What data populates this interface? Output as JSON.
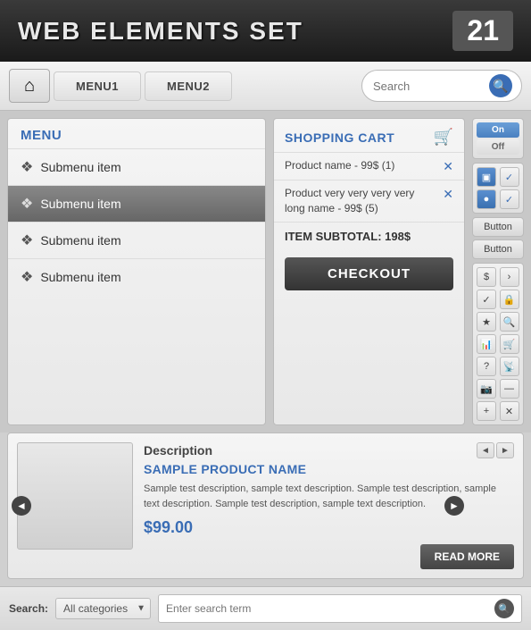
{
  "header": {
    "title": "WEB ELEMENTS SET",
    "number": "21"
  },
  "navbar": {
    "home_icon": "⌂",
    "menu1_label": "MENU1",
    "menu2_label": "MENU2",
    "search_placeholder": "Search"
  },
  "menu": {
    "title": "MENU",
    "items": [
      {
        "label": "Submenu item",
        "active": false
      },
      {
        "label": "Submenu item",
        "active": true
      },
      {
        "label": "Submenu item",
        "active": false
      },
      {
        "label": "Submenu item",
        "active": false
      }
    ]
  },
  "cart": {
    "title": "SHOPPING CART",
    "cart_icon": "🛒",
    "items": [
      {
        "text": "Product name - 99$ (1)"
      },
      {
        "text": "Product very very very very long name - 99$ (5)"
      }
    ],
    "subtotal_label": "ITEM SUBTOTAL: 198$",
    "checkout_label": "CHECKOUT"
  },
  "sidebar": {
    "toggle_on": "On",
    "toggle_off": "Off",
    "icons": [
      "▣",
      "✓",
      "●",
      "✓"
    ],
    "btn1": "Button",
    "btn2": "Button",
    "icon_symbols": [
      "$",
      ">",
      "✓",
      "🔒",
      "★",
      "🔍",
      "📊",
      "🛒",
      "?",
      "📡",
      "📷",
      "—",
      "+",
      "✕"
    ]
  },
  "product": {
    "desc_label": "Description",
    "name": "SAMPLE PRODUCT NAME",
    "description": "Sample test description, sample text description. Sample test description, sample text description. Sample test description, sample text description.",
    "price": "$99.00",
    "read_more_label": "READ MORE",
    "prev_icon": "◄",
    "next_icon": "►",
    "arrow_left": "◄",
    "arrow_right": "►"
  },
  "search": {
    "label": "Search:",
    "category_default": "All categories",
    "input_placeholder": "Enter search term",
    "go_icon": "🔍"
  }
}
